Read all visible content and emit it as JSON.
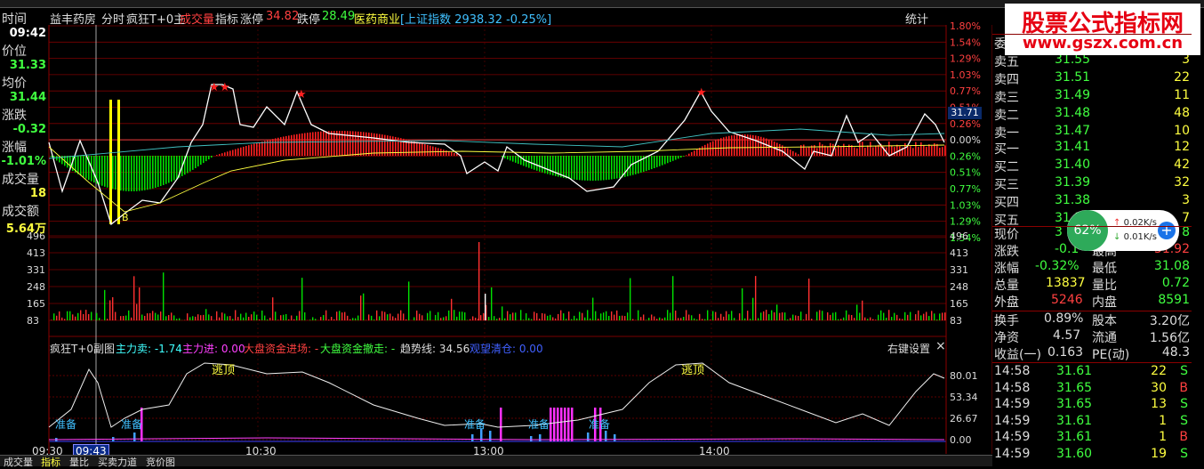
{
  "header": {
    "stock_name": "益丰药房",
    "tab_intraday": "分时",
    "indicator_main": "疯狂T+0主",
    "volume_label": "成交量",
    "indicator_label": "指标",
    "limit_up_label": "涨停",
    "limit_up_value": "34.82",
    "limit_down_label": "跌停",
    "limit_down_value": "28.49",
    "sector": "医药商业",
    "index_info": "[上证指数 2938.32 -0.25%]",
    "stats_button": "统计"
  },
  "left_panel": {
    "time_label": "时间",
    "time_value": "09:42",
    "price_label": "价位",
    "price_value": "31.33",
    "avg_label": "均价",
    "avg_value": "31.44",
    "change_label": "涨跌",
    "change_value": "-0.32",
    "pct_label": "涨幅",
    "pct_value": "-1.01%",
    "vol_label": "成交量",
    "vol_value": "18",
    "amount_label": "成交额",
    "amount_value": "5.64万"
  },
  "price_axis_labels": [
    "1.80%",
    "1.54%",
    "1.29%",
    "1.03%",
    "0.77%",
    "0.51%",
    "0.26%",
    "0.00%",
    "0.26%",
    "0.51%",
    "0.77%",
    "1.03%",
    "1.29%",
    "1.54%"
  ],
  "current_price_tag": "31.71",
  "volume_axis_labels": [
    "496",
    "413",
    "331",
    "248",
    "165",
    "83"
  ],
  "indicator_header": {
    "name": "疯狂T+0副图",
    "main_force_sell": "主力卖: -1.74",
    "main_force_buy": "主力进: 0.00",
    "big_fund_in": "大盘资金进场: -",
    "big_fund_out": "大盘资金撤走: -",
    "trend_line": "趋势线: 34.56",
    "clear_position": "观望清仓: 0.00",
    "settings": "右键设置"
  },
  "indicator_axis_labels": [
    "80.01",
    "53.34",
    "26.67",
    "0.00"
  ],
  "indicator_annotations": {
    "ready": "准备",
    "escape_top": "逃顶",
    "buy_b": "B"
  },
  "time_axis": [
    "09:30",
    "09:43",
    "10:30",
    "13:00",
    "14:00"
  ],
  "order_book": {
    "sell_header": "委",
    "sells": [
      {
        "label": "卖五",
        "price": "31.55",
        "vol": "3"
      },
      {
        "label": "卖四",
        "price": "31.51",
        "vol": "22"
      },
      {
        "label": "卖三",
        "price": "31.49",
        "vol": "11"
      },
      {
        "label": "卖二",
        "price": "31.48",
        "vol": "48"
      },
      {
        "label": "卖一",
        "price": "31.47",
        "vol": "10"
      }
    ],
    "buys": [
      {
        "label": "买一",
        "price": "31.41",
        "vol": "12"
      },
      {
        "label": "买二",
        "price": "31.40",
        "vol": "42"
      },
      {
        "label": "买三",
        "price": "31.39",
        "vol": "32"
      },
      {
        "label": "买四",
        "price": "31.38",
        "vol": "3"
      },
      {
        "label": "买五",
        "price": "31.3",
        "vol": "7"
      }
    ]
  },
  "quote": {
    "now_label": "现价",
    "now_value": "3",
    "now_right": "8",
    "chg_label": "涨跌",
    "chg_value": "-0.1",
    "high_label": "最高",
    "high_value": "31.92",
    "pct_label": "涨幅",
    "pct_value": "-0.32%",
    "low_label": "最低",
    "low_value": "31.08",
    "total_label": "总量",
    "total_value": "13837",
    "ratio_label": "量比",
    "ratio_value": "0.72",
    "outer_label": "外盘",
    "outer_value": "5246",
    "inner_label": "内盘",
    "inner_value": "8591",
    "turnover_label": "换手",
    "turnover_value": "0.89%",
    "shares_label": "股本",
    "shares_value": "3.20亿",
    "net_label": "净资",
    "net_value": "4.57",
    "float_label": "流通",
    "float_value": "1.56亿",
    "eps_label": "收益(一)",
    "eps_value": "0.163",
    "pe_label": "PE(动)",
    "pe_value": "48.3"
  },
  "ticks": [
    {
      "time": "14:58",
      "price": "31.61",
      "vol": "22",
      "side": "S"
    },
    {
      "time": "14:58",
      "price": "31.65",
      "vol": "30",
      "side": "B"
    },
    {
      "time": "14:59",
      "price": "31.65",
      "vol": "13",
      "side": "S"
    },
    {
      "time": "14:59",
      "price": "31.61",
      "vol": "1",
      "side": "S"
    },
    {
      "time": "14:59",
      "price": "31.61",
      "vol": "1",
      "side": "B"
    },
    {
      "time": "14:59",
      "price": "31.60",
      "vol": "19",
      "side": "S"
    }
  ],
  "watermark": {
    "title": "股票公式指标网",
    "url": "www.gszx.com.cn"
  },
  "net_widget": {
    "percent": "62%",
    "up_rate": "0.02K/s",
    "down_rate": "0.01K/s"
  },
  "bottom_tabs": [
    "成交量",
    "指标",
    "量比",
    "买卖力道",
    "竞价图"
  ],
  "colors": {
    "up": "#ff3232",
    "down": "#00e600",
    "price_line": "#ffffff",
    "avg_line": "#ffff00",
    "grid": "#8b0000"
  }
}
